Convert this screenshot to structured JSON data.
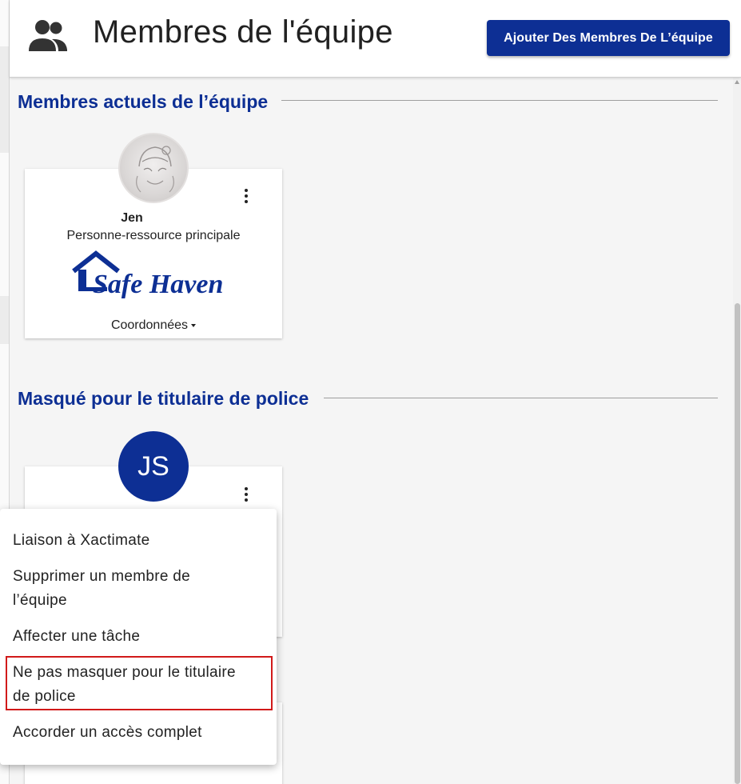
{
  "header": {
    "title": "Membres de l'équipe",
    "icon": "team-icon",
    "add_button_label": "Ajouter Des Membres De L’équipe"
  },
  "sections": {
    "current": {
      "title": "Membres actuels de l’équipe"
    },
    "hidden": {
      "title": "Masqué pour le titulaire de police"
    }
  },
  "current_member": {
    "name": "Jen",
    "role": "Personne-ressource principale",
    "company_logo_text": "Safe Haven",
    "contact_label": "Coordonnées"
  },
  "hidden_member": {
    "initials": "JS"
  },
  "menu": {
    "items": [
      {
        "label": "Liaison à Xactimate"
      },
      {
        "label_line1": "Supprimer un membre de",
        "label_line2": "l’équipe"
      },
      {
        "label": "Affecter une tâche"
      },
      {
        "label_line1": "Ne pas masquer pour le titulaire",
        "label_line2": "de police"
      },
      {
        "label": "Accorder un accès complet"
      }
    ]
  },
  "colors": {
    "brand": "#0d2f94",
    "highlight": "#d11a1a"
  }
}
